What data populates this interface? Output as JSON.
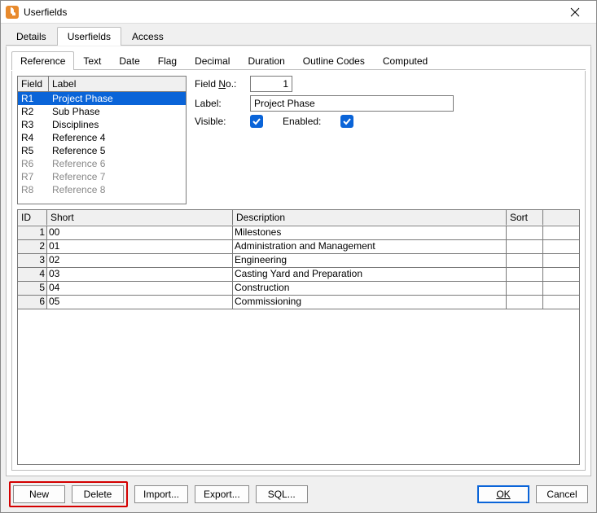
{
  "window": {
    "title": "Userfields"
  },
  "tabs1": {
    "items": [
      "Details",
      "Userfields",
      "Access"
    ],
    "active": 1
  },
  "tabs2": {
    "items": [
      "Reference",
      "Text",
      "Date",
      "Flag",
      "Decimal",
      "Duration",
      "Outline Codes",
      "Computed"
    ],
    "active": 0
  },
  "fieldList": {
    "head": {
      "field": "Field",
      "label": "Label"
    },
    "rows": [
      {
        "id": "R1",
        "label": "Project Phase",
        "selected": true,
        "enabled": true
      },
      {
        "id": "R2",
        "label": "Sub Phase",
        "selected": false,
        "enabled": true
      },
      {
        "id": "R3",
        "label": "Disciplines",
        "selected": false,
        "enabled": true
      },
      {
        "id": "R4",
        "label": "Reference 4",
        "selected": false,
        "enabled": true
      },
      {
        "id": "R5",
        "label": "Reference 5",
        "selected": false,
        "enabled": true
      },
      {
        "id": "R6",
        "label": "Reference 6",
        "selected": false,
        "enabled": false
      },
      {
        "id": "R7",
        "label": "Reference 7",
        "selected": false,
        "enabled": false
      },
      {
        "id": "R8",
        "label": "Reference 8",
        "selected": false,
        "enabled": false
      }
    ]
  },
  "props": {
    "fieldNoLabelPrefix": "Field ",
    "fieldNoLabelKey": "N",
    "fieldNoLabelSuffix": "o.:",
    "fieldNoValue": "1",
    "labelLabel": "Label:",
    "labelValue": "Project Phase",
    "visibleLabel": "Visible:",
    "visibleChecked": true,
    "enabledLabel": "Enabled:",
    "enabledChecked": true
  },
  "grid": {
    "head": {
      "id": "ID",
      "short": "Short",
      "desc": "Description",
      "sort": "Sort"
    },
    "rows": [
      {
        "id": "1",
        "short": "00",
        "desc": "Milestones",
        "sort": ""
      },
      {
        "id": "2",
        "short": "01",
        "desc": "Administration and Management",
        "sort": ""
      },
      {
        "id": "3",
        "short": "02",
        "desc": "Engineering",
        "sort": ""
      },
      {
        "id": "4",
        "short": "03",
        "desc": "Casting Yard and Preparation",
        "sort": ""
      },
      {
        "id": "5",
        "short": "04",
        "desc": "Construction",
        "sort": ""
      },
      {
        "id": "6",
        "short": "05",
        "desc": "Commissioning",
        "sort": ""
      }
    ]
  },
  "buttons": {
    "new": "New",
    "delete": "Delete",
    "import": "Import...",
    "export": "Export...",
    "sql": "SQL...",
    "ok": "OK",
    "cancel": "Cancel"
  }
}
